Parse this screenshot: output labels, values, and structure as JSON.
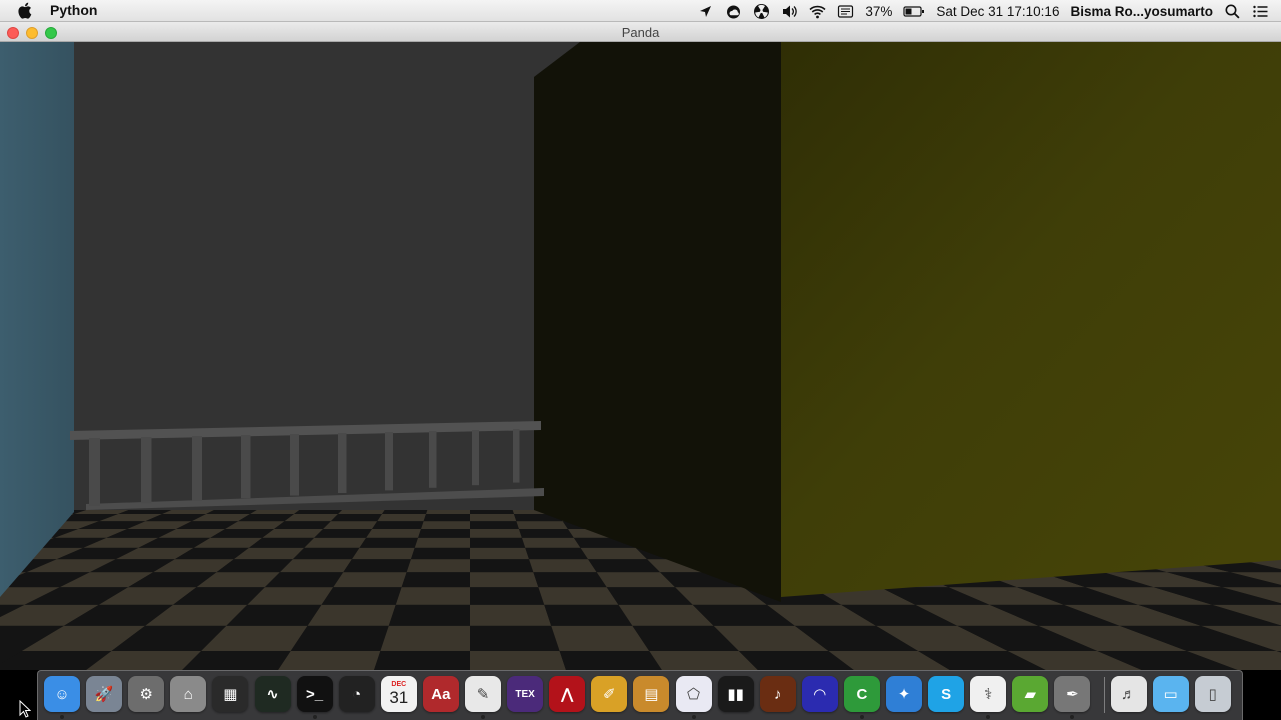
{
  "menubar": {
    "app_name": "Python",
    "battery": "37%",
    "datetime": "Sat Dec 31  17:10:16",
    "user": "Bisma Ro...yosumarto",
    "status_icons": [
      "location-icon",
      "creative-cloud-icon",
      "radioactive-icon",
      "volume-icon",
      "wifi-icon",
      "input-menu-icon",
      "battery-icon",
      "spotlight-icon",
      "notification-center-icon"
    ]
  },
  "window": {
    "title": "Panda"
  },
  "scene": {
    "colors": {
      "left_wall": "#3a5866",
      "back_wall": "#333333",
      "shadow_wall": "#121208",
      "yellow_wall": "#3c3b08",
      "floor_dark": "#141414",
      "floor_light": "#3b362c",
      "railing": "#4a4a4a"
    }
  },
  "dock": {
    "calendar_month": "DEC",
    "calendar_day": "31",
    "items": [
      {
        "name": "finder",
        "glyph": "☺",
        "color": "#3a8ee6",
        "running": true
      },
      {
        "name": "launchpad",
        "glyph": "🚀",
        "color": "#7a8594",
        "running": false
      },
      {
        "name": "system-preferences",
        "glyph": "⚙",
        "color": "#6d6d6d",
        "running": false
      },
      {
        "name": "network-utility",
        "glyph": "⌂",
        "color": "#8a8a8a",
        "running": false
      },
      {
        "name": "mission-control",
        "glyph": "▦",
        "color": "#2a2a2a",
        "running": false
      },
      {
        "name": "activity-monitor",
        "glyph": "∿",
        "color": "#1f2a22",
        "running": false
      },
      {
        "name": "terminal",
        "glyph": ">_",
        "color": "#111111",
        "running": true
      },
      {
        "name": "dashboard",
        "glyph": "◔",
        "color": "#222222",
        "running": false
      },
      {
        "name": "calendar",
        "glyph": "",
        "color": "#f2f2f2",
        "running": false
      },
      {
        "name": "dictionary",
        "glyph": "Aa",
        "color": "#b0292c",
        "running": false
      },
      {
        "name": "textedit",
        "glyph": "✎",
        "color": "#e8e8e8",
        "running": true
      },
      {
        "name": "texshop",
        "glyph": "TEX",
        "color": "#4b2a7a",
        "running": false
      },
      {
        "name": "adobe-reader",
        "glyph": "⋀",
        "color": "#b3121a",
        "running": false
      },
      {
        "name": "paint-app",
        "glyph": "✐",
        "color": "#d9a126",
        "running": false
      },
      {
        "name": "calculator",
        "glyph": "▤",
        "color": "#c98a2c",
        "running": false
      },
      {
        "name": "geogebra",
        "glyph": "⬠",
        "color": "#e9e9f3",
        "running": true
      },
      {
        "name": "music-app",
        "glyph": "▮▮",
        "color": "#1a1a1a",
        "running": false
      },
      {
        "name": "instrument-app",
        "glyph": "♪",
        "color": "#6a2d12",
        "running": false
      },
      {
        "name": "audacity",
        "glyph": "◠",
        "color": "#2b2bb0",
        "running": false
      },
      {
        "name": "camtasia",
        "glyph": "C",
        "color": "#2e9a3a",
        "running": true
      },
      {
        "name": "safari",
        "glyph": "✦",
        "color": "#2f7fd6",
        "running": false
      },
      {
        "name": "skype",
        "glyph": "S",
        "color": "#1fa3e6",
        "running": false
      },
      {
        "name": "python",
        "glyph": "⚕",
        "color": "#f0f0f0",
        "running": true
      },
      {
        "name": "bluestacks",
        "glyph": "▰",
        "color": "#5aa832",
        "running": false
      },
      {
        "name": "inkscape",
        "glyph": "✒",
        "color": "#777777",
        "running": true
      },
      {
        "name": "document-file",
        "glyph": "♬",
        "color": "#e5e5e5",
        "running": false
      },
      {
        "name": "downloads-folder",
        "glyph": "▭",
        "color": "#5ab4ef",
        "running": false
      },
      {
        "name": "trash",
        "glyph": "▯",
        "color": "#c6ccd3",
        "running": false
      }
    ]
  }
}
